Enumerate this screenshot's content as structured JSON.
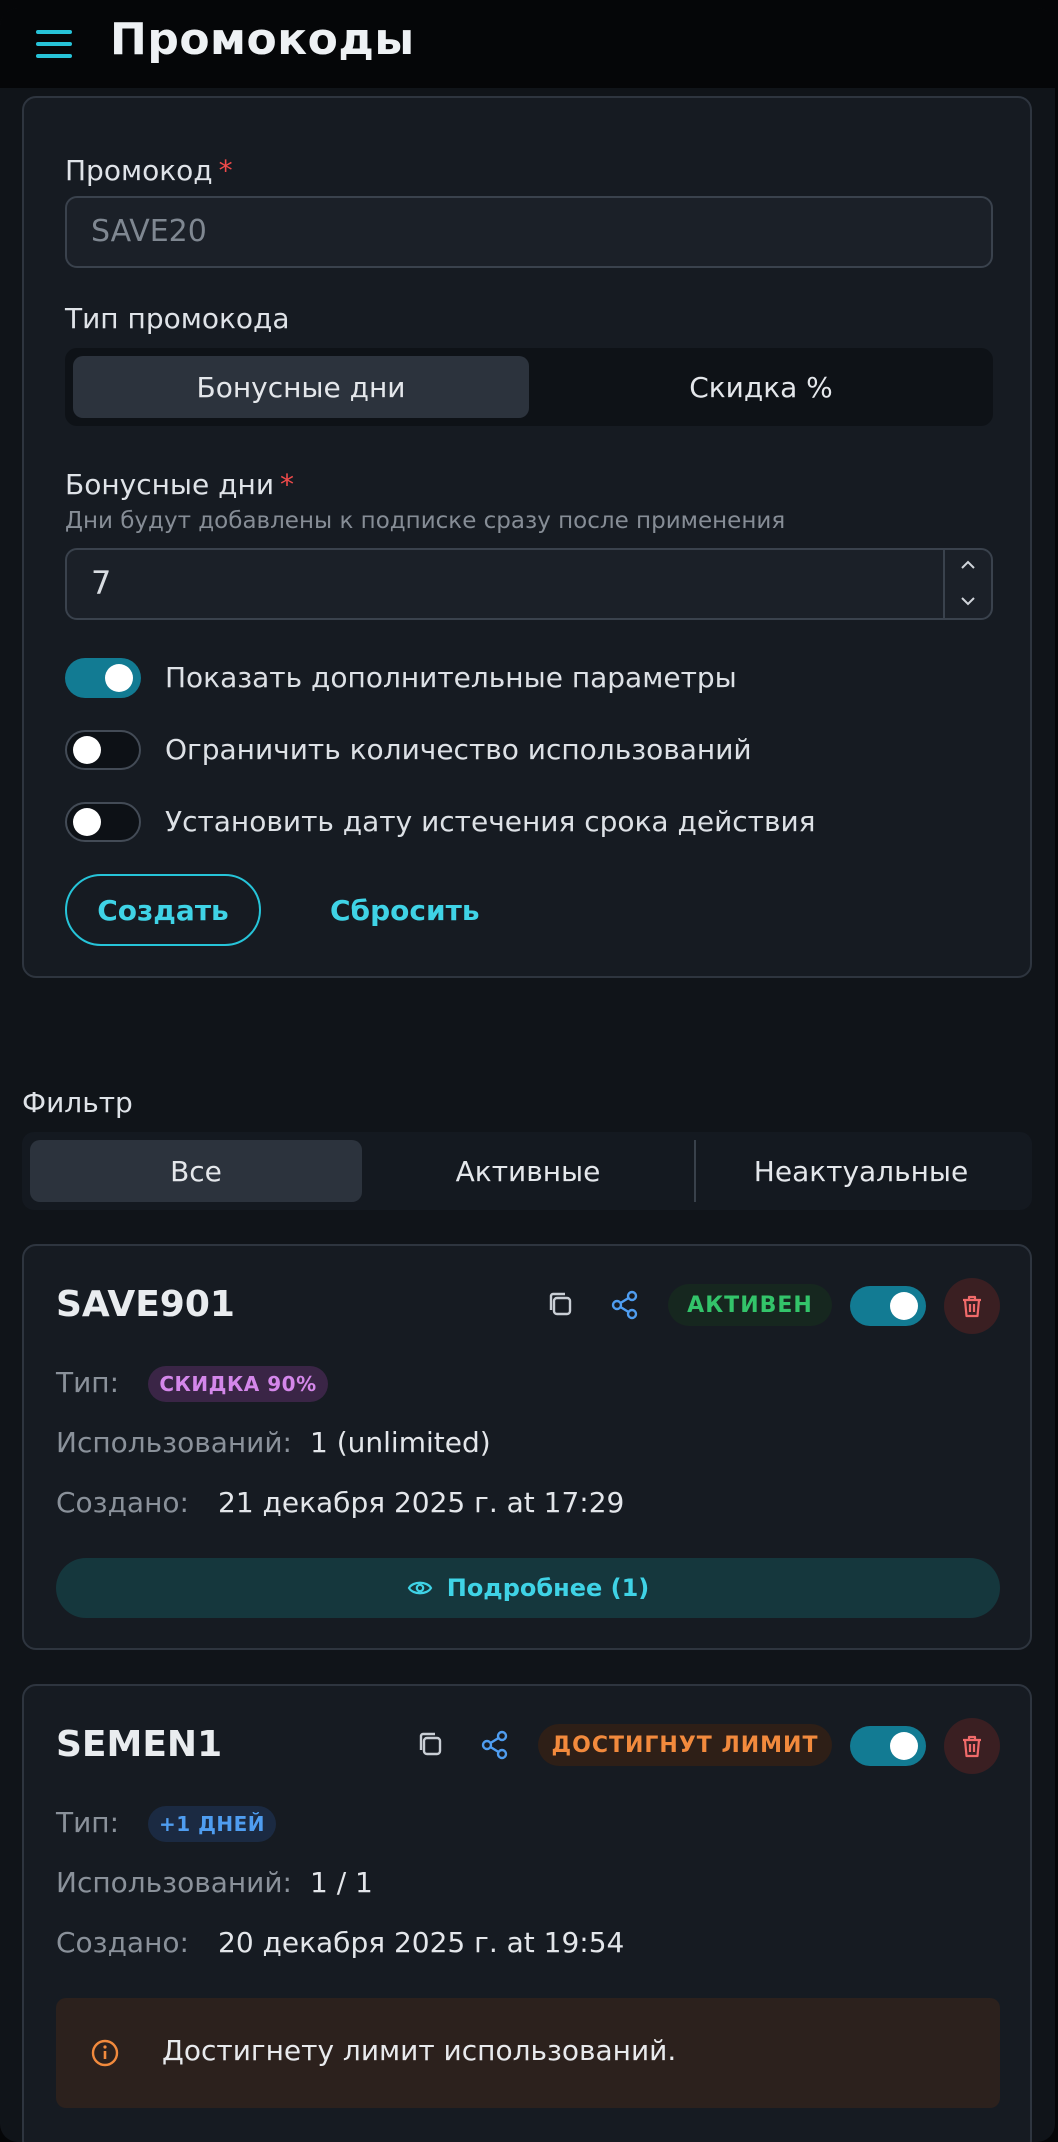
{
  "header": {
    "title": "Промокоды",
    "menu_icon": "hamburger-menu-icon"
  },
  "form": {
    "code_label": "Промокод",
    "required_mark": "*",
    "code_placeholder": "SAVE20",
    "type_label": "Тип промокода",
    "type_options": [
      "Бонусные дни",
      "Скидка %"
    ],
    "type_selected": "Бонусные дни",
    "days_label": "Бонусные дни",
    "days_hint": "Дни будут добавлены к подписке сразу после применения",
    "days_value": "7",
    "toggles": [
      {
        "label": "Показать дополнительные параметры",
        "on": true
      },
      {
        "label": "Ограничить количество использований",
        "on": false
      },
      {
        "label": "Установить дату истечения срока действия",
        "on": false
      }
    ],
    "create_label": "Создать",
    "reset_label": "Сбросить"
  },
  "filter": {
    "label": "Фильтр",
    "options": [
      "Все",
      "Активные",
      "Неактуальные"
    ],
    "selected": "Все"
  },
  "promos": [
    {
      "code": "SAVE901",
      "status": "АКТИВЕН",
      "enabled": true,
      "type_label": "Тип:",
      "type_chip": "СКИДКА 90%",
      "uses_label": "Использований:",
      "uses_value": "1 (unlimited)",
      "created_label": "Создано:",
      "created_value": "21 декабря 2025 г. at 17:29",
      "details_label": "Подробнее (1)"
    },
    {
      "code": "SEMEN1",
      "status": "ДОСТИГНУТ ЛИМИТ",
      "enabled": true,
      "type_label": "Тип:",
      "type_chip": "+1 ДНЕЙ",
      "uses_label": "Использований:",
      "uses_value": "1 / 1",
      "created_label": "Создано:",
      "created_value": "20 декабря 2025 г. at 19:54",
      "warning": "Достигнету лимит использований."
    }
  ],
  "colors": {
    "accent": "#26c4d9",
    "toggle_on": "#127b93",
    "status_active": "#33c46a",
    "status_limit": "#f28a3d",
    "danger": "#f06a6a"
  }
}
